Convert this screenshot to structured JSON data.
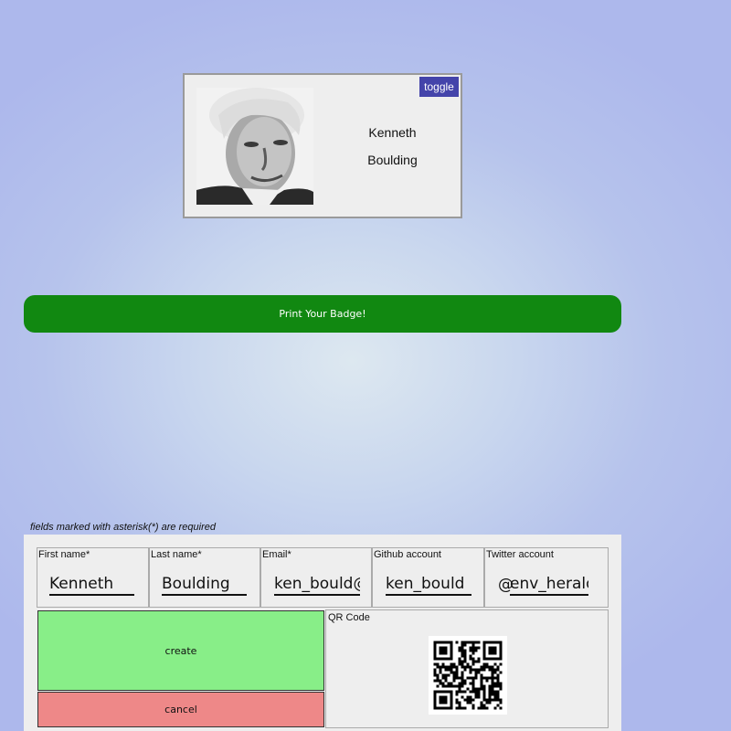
{
  "badge": {
    "first_name": "Kenneth",
    "last_name": "Boulding",
    "toggle_label": "toggle",
    "photo_icon": "portrait-photo"
  },
  "print_button": {
    "label": "Print Your Badge!"
  },
  "form": {
    "required_note": "fields marked with asterisk(*) are required",
    "fields": [
      {
        "label": "First name*",
        "value": "Kenneth"
      },
      {
        "label": "Last name*",
        "value": "Boulding"
      },
      {
        "label": "Email*",
        "value": "ken_bould@"
      },
      {
        "label": "Github account",
        "value": "ken_bould"
      },
      {
        "label": "Twitter account",
        "prefix": "@",
        "value": "env_herald"
      }
    ],
    "create_label": "create",
    "cancel_label": "cancel",
    "qr_label": "QR Code"
  },
  "colors": {
    "print_button": "#118811",
    "toggle": "#4444aa",
    "create": "#88ee88",
    "cancel": "#ee8888"
  }
}
